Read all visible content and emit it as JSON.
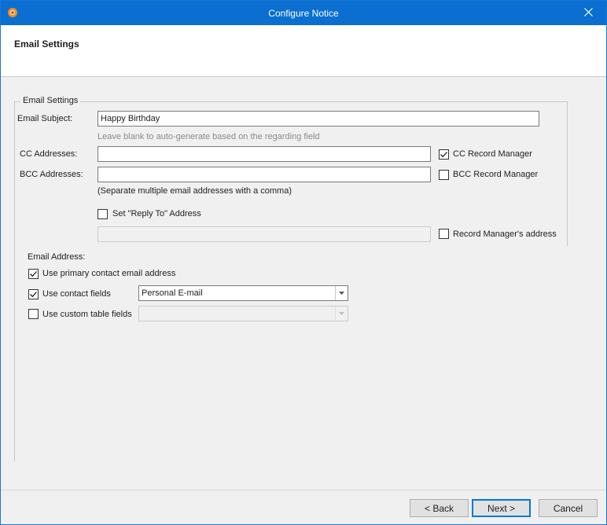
{
  "window": {
    "title": "Configure Notice"
  },
  "header": {
    "title": "Email Settings"
  },
  "group": {
    "title": "Email Settings",
    "email_subject_label": "Email Subject:",
    "email_subject_value": "Happy Birthday",
    "subject_hint": "Leave blank to auto-generate based on the regarding field",
    "cc_label": "CC Addresses:",
    "cc_value": "",
    "bcc_label": "BCC Addresses:",
    "bcc_value": "",
    "cc_record_manager_label": "CC Record Manager",
    "cc_record_manager_checked": true,
    "bcc_record_manager_label": "BCC Record Manager",
    "bcc_record_manager_checked": false,
    "separator_hint": "(Separate multiple email addresses with a comma)",
    "reply_to_label": "Set \"Reply To\" Address",
    "reply_to_checked": false,
    "reply_to_value": "",
    "record_manager_address_label": "Record Manager's address",
    "record_manager_address_checked": false
  },
  "email_address": {
    "label": "Email Address:",
    "use_primary_label": "Use primary contact email address",
    "use_primary_checked": true,
    "use_contact_fields_label": "Use contact fields",
    "use_contact_fields_checked": true,
    "contact_field_selected": "Personal E-mail",
    "use_custom_table_label": "Use custom table fields",
    "use_custom_table_checked": false,
    "custom_table_selected": ""
  },
  "footer": {
    "back_label": "< Back",
    "next_label": "Next >",
    "cancel_label": "Cancel"
  }
}
